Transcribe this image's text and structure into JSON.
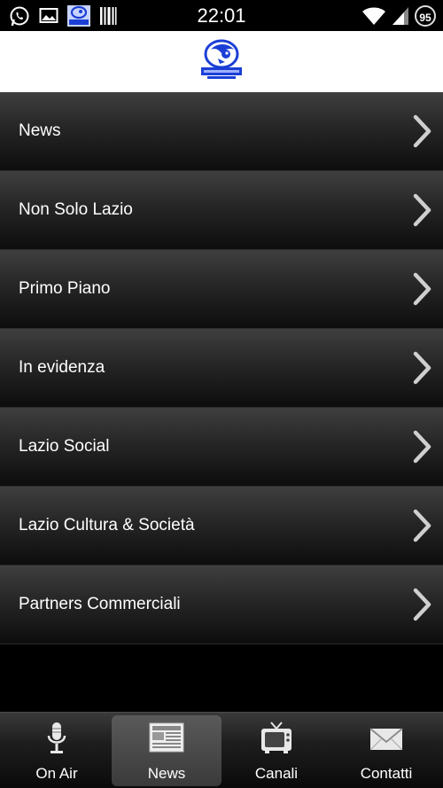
{
  "status_bar": {
    "time": "22:01",
    "battery": "95",
    "icons": [
      "whatsapp-icon",
      "gallery-icon",
      "app-logo-icon",
      "barcode-icon",
      "wifi-icon",
      "signal-icon",
      "battery-icon"
    ]
  },
  "menu": {
    "items": [
      {
        "label": "News"
      },
      {
        "label": "Non Solo Lazio"
      },
      {
        "label": "Primo Piano"
      },
      {
        "label": "In evidenza"
      },
      {
        "label": "Lazio Social"
      },
      {
        "label": "Lazio Cultura & Società"
      },
      {
        "label": "Partners Commerciali"
      }
    ]
  },
  "tabs": [
    {
      "label": "On Air",
      "icon": "microphone-icon",
      "active": false
    },
    {
      "label": "News",
      "icon": "newspaper-icon",
      "active": true
    },
    {
      "label": "Canali",
      "icon": "tv-icon",
      "active": false
    },
    {
      "label": "Contatti",
      "icon": "envelope-icon",
      "active": false
    }
  ],
  "colors": {
    "header_bg": "#ffffff",
    "logo_blue": "#1b3fd6",
    "list_top": "#3f3f3f",
    "list_bottom": "#0d0d0d",
    "chevron": "#cfcfcf"
  }
}
